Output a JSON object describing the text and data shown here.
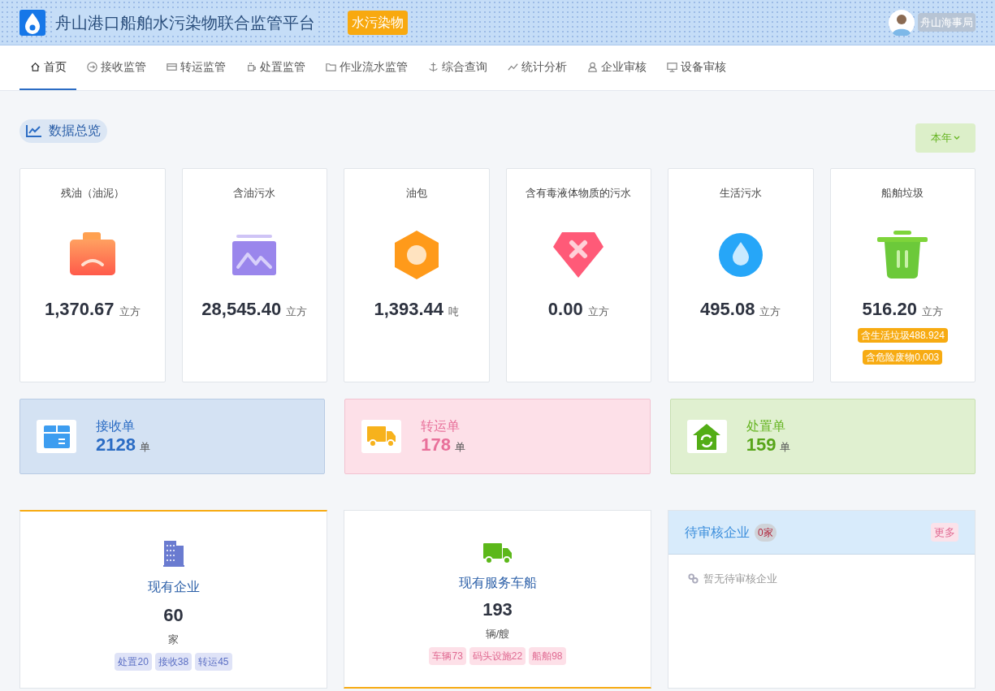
{
  "header": {
    "title": "舟山港口船舶水污染物联合监管平台",
    "badge": "水污染物",
    "user": "舟山海事局"
  },
  "nav": [
    {
      "label": "首页",
      "selected": true
    },
    {
      "label": "接收监管",
      "selected": false
    },
    {
      "label": "转运监管",
      "selected": false
    },
    {
      "label": "处置监管",
      "selected": false
    },
    {
      "label": "作业流水监管",
      "selected": false
    },
    {
      "label": "综合查询",
      "selected": false
    },
    {
      "label": "统计分析",
      "selected": false
    },
    {
      "label": "企业审核",
      "selected": false
    },
    {
      "label": "设备审核",
      "selected": false
    }
  ],
  "overview": {
    "title": "数据总览",
    "period": "本年"
  },
  "stats": [
    {
      "kind": "sludge",
      "title": "残油（油泥）",
      "value": "1,370.67",
      "unit": "立方"
    },
    {
      "kind": "oily",
      "title": "含油污水",
      "value": "28,545.40",
      "unit": "立方"
    },
    {
      "kind": "oilbag",
      "title": "油包",
      "value": "1,393.44",
      "unit": "吨"
    },
    {
      "kind": "toxic",
      "title": "含有毒液体物质的污水",
      "value": "0.00",
      "unit": "立方"
    },
    {
      "kind": "sewage",
      "title": "生活污水",
      "value": "495.08",
      "unit": "立方"
    },
    {
      "kind": "garbage",
      "title": "船舶垃圾",
      "value": "516.20",
      "unit": "立方",
      "tags": [
        "含生活垃圾488.924",
        "含危险废物0.003"
      ]
    }
  ],
  "orders": [
    {
      "kind": "receive",
      "title": "接收单",
      "value": "2128",
      "unit": "单"
    },
    {
      "kind": "transfer",
      "title": "转运单",
      "value": "178",
      "unit": "单"
    },
    {
      "kind": "dispose",
      "title": "处置单",
      "value": "159",
      "unit": "单"
    }
  ],
  "enterprises": {
    "title": "现有企业",
    "value": "60",
    "unit": "家",
    "tags": [
      "处置20",
      "接收38",
      "转运45"
    ]
  },
  "vehicles": {
    "title": "现有服务车船",
    "value": "193",
    "unit": "辆/艘",
    "tags": [
      "车辆73",
      "码头设施22",
      "船舶98"
    ]
  },
  "pending": {
    "title": "待审核企业",
    "count": "0家",
    "more": "更多",
    "empty": "暂无待审核企业"
  }
}
